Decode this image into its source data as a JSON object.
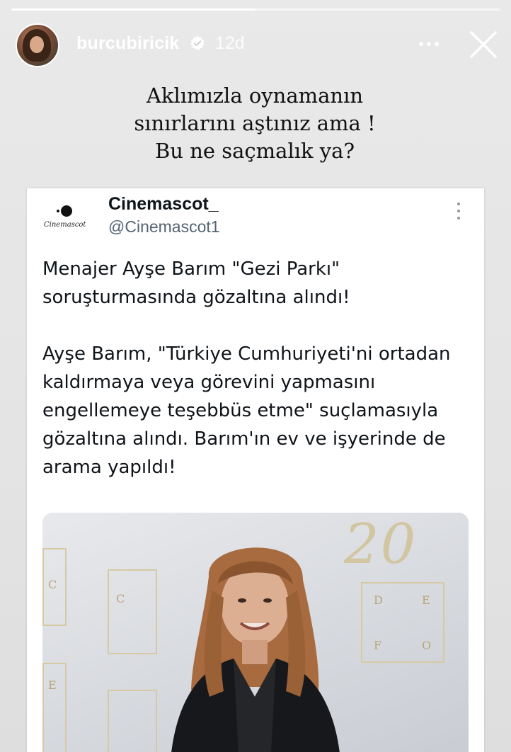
{
  "story": {
    "progress": 0.5,
    "username": "burcubiricik",
    "time_ago": "12d",
    "caption_lines": [
      "Aklımızla oynamanın",
      "sınırlarını aştınız ama !",
      "Bu ne saçmalık ya?"
    ]
  },
  "tweet": {
    "logo_text": "Cinemascot",
    "display_name": "Cinemascot_",
    "handle": "@Cinemascot1",
    "paragraph_1": "Menajer Ayşe Barım \"Gezi Parkı\" soruşturmasında gözaltına alındı!",
    "paragraph_2": "Ayşe Barım, \"Türkiye Cumhuriyeti'ni ortadan kaldırmaya veya görevini yapmasını engellemeye teşebbüs etme\" suçlamasıyla gözaltına alındı. Barım'ın ev ve işyerinde de arama yapıldı!",
    "media": {
      "backdrop_number": "20",
      "backdrop_letters": [
        "D",
        "E",
        "F",
        "O",
        "C",
        "E",
        "C"
      ]
    }
  }
}
